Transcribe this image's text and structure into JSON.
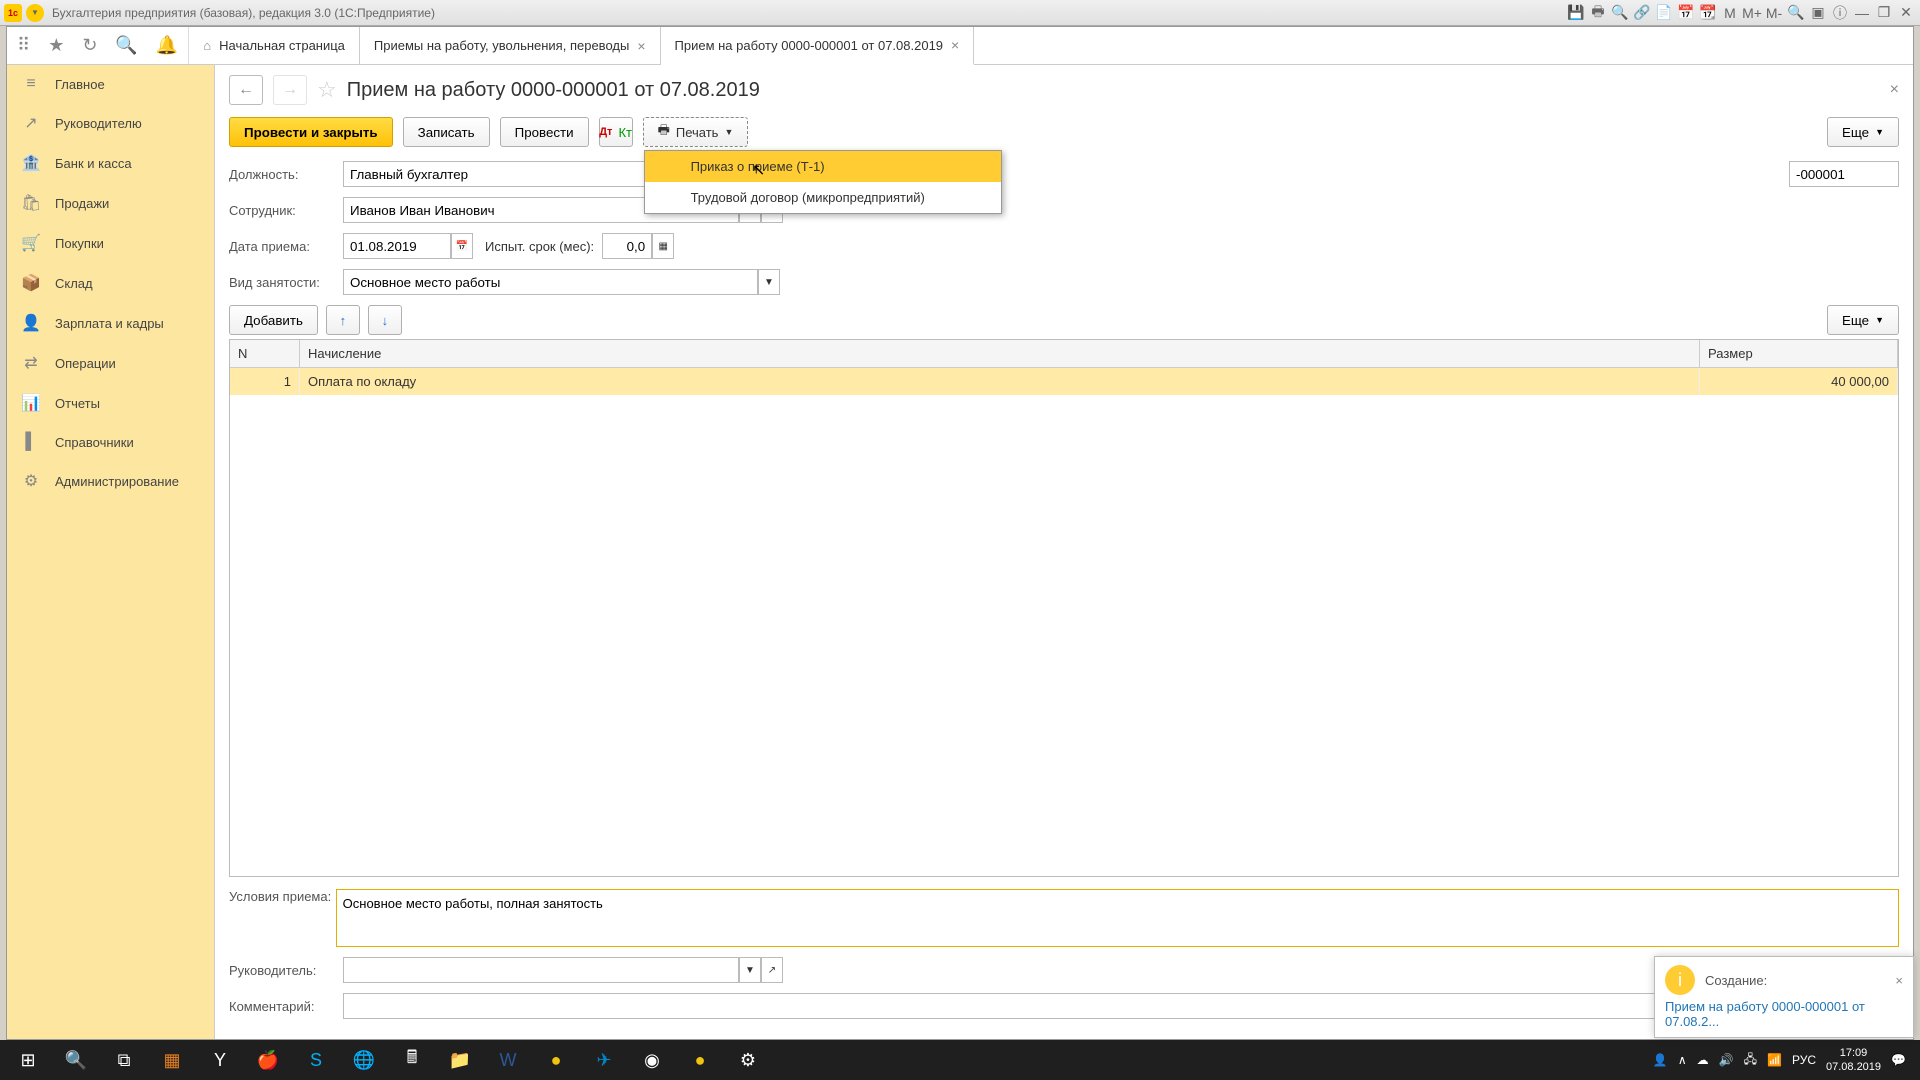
{
  "app_title": "Бухгалтерия предприятия (базовая), редакция 3.0  (1С:Предприятие)",
  "tabs": {
    "home": "Начальная страница",
    "t1": "Приемы на работу, увольнения, переводы",
    "t2": "Прием на работу 0000-000001 от 07.08.2019"
  },
  "sidebar": [
    {
      "icon": "≡",
      "label": "Главное"
    },
    {
      "icon": "↗",
      "label": "Руководителю"
    },
    {
      "icon": "🏦",
      "label": "Банк и касса"
    },
    {
      "icon": "🛍",
      "label": "Продажи"
    },
    {
      "icon": "🛒",
      "label": "Покупки"
    },
    {
      "icon": "📦",
      "label": "Склад"
    },
    {
      "icon": "👤",
      "label": "Зарплата и кадры"
    },
    {
      "icon": "⇄",
      "label": "Операции"
    },
    {
      "icon": "📊",
      "label": "Отчеты"
    },
    {
      "icon": "▌",
      "label": "Справочники"
    },
    {
      "icon": "⚙",
      "label": "Администрирование"
    }
  ],
  "doc": {
    "title": "Прием на работу 0000-000001 от 07.08.2019",
    "btn_post_close": "Провести и закрыть",
    "btn_save": "Записать",
    "btn_post": "Провести",
    "btn_print": "Печать",
    "btn_more": "Еще",
    "print_menu": {
      "item1": "Приказ о приеме (Т-1)",
      "item2": "Трудовой договор (микропредприятий)"
    },
    "labels": {
      "position": "Должность:",
      "employee": "Сотрудник:",
      "hire_date": "Дата приема:",
      "probation": "Испыт. срок (мес):",
      "employment": "Вид занятости:",
      "btn_add": "Добавить",
      "conditions": "Условия приема:",
      "manager": "Руководитель:",
      "comment": "Комментарий:"
    },
    "values": {
      "position": "Главный бухгалтер",
      "employee": "Иванов Иван Иванович",
      "number": "-000001",
      "hire_date": "01.08.2019",
      "probation": "0,0",
      "employment": "Основное место работы",
      "conditions": "Основное место работы, полная занятость",
      "manager": "",
      "comment": ""
    },
    "table": {
      "headers": {
        "n": "N",
        "name": "Начисление",
        "size": "Размер"
      },
      "rows": [
        {
          "n": "1",
          "name": "Оплата по окладу",
          "size": "40 000,00"
        }
      ]
    }
  },
  "notification": {
    "title": "Создание:",
    "link": "Прием на работу 0000-000001 от 07.08.2..."
  },
  "tray": {
    "lang": "РУС",
    "time": "17:09",
    "date": "07.08.2019"
  }
}
